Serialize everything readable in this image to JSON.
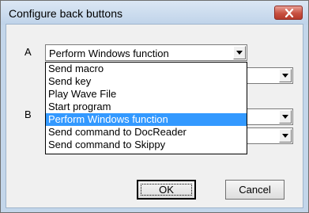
{
  "window": {
    "title": "Configure back buttons"
  },
  "labels": {
    "a": "A",
    "b": "B"
  },
  "combo_a": {
    "value": "Perform Windows function"
  },
  "combo_a2": {
    "value": ""
  },
  "combo_b": {
    "value": ""
  },
  "combo_b2": {
    "value": ""
  },
  "dropdown": {
    "options": [
      "Send macro",
      "Send key",
      "Play Wave File",
      "Start program",
      "Perform Windows function",
      "Send command to DocReader",
      "Send command to Skippy"
    ],
    "selected": "Perform Windows function"
  },
  "buttons": {
    "ok": "OK",
    "cancel": "Cancel"
  }
}
